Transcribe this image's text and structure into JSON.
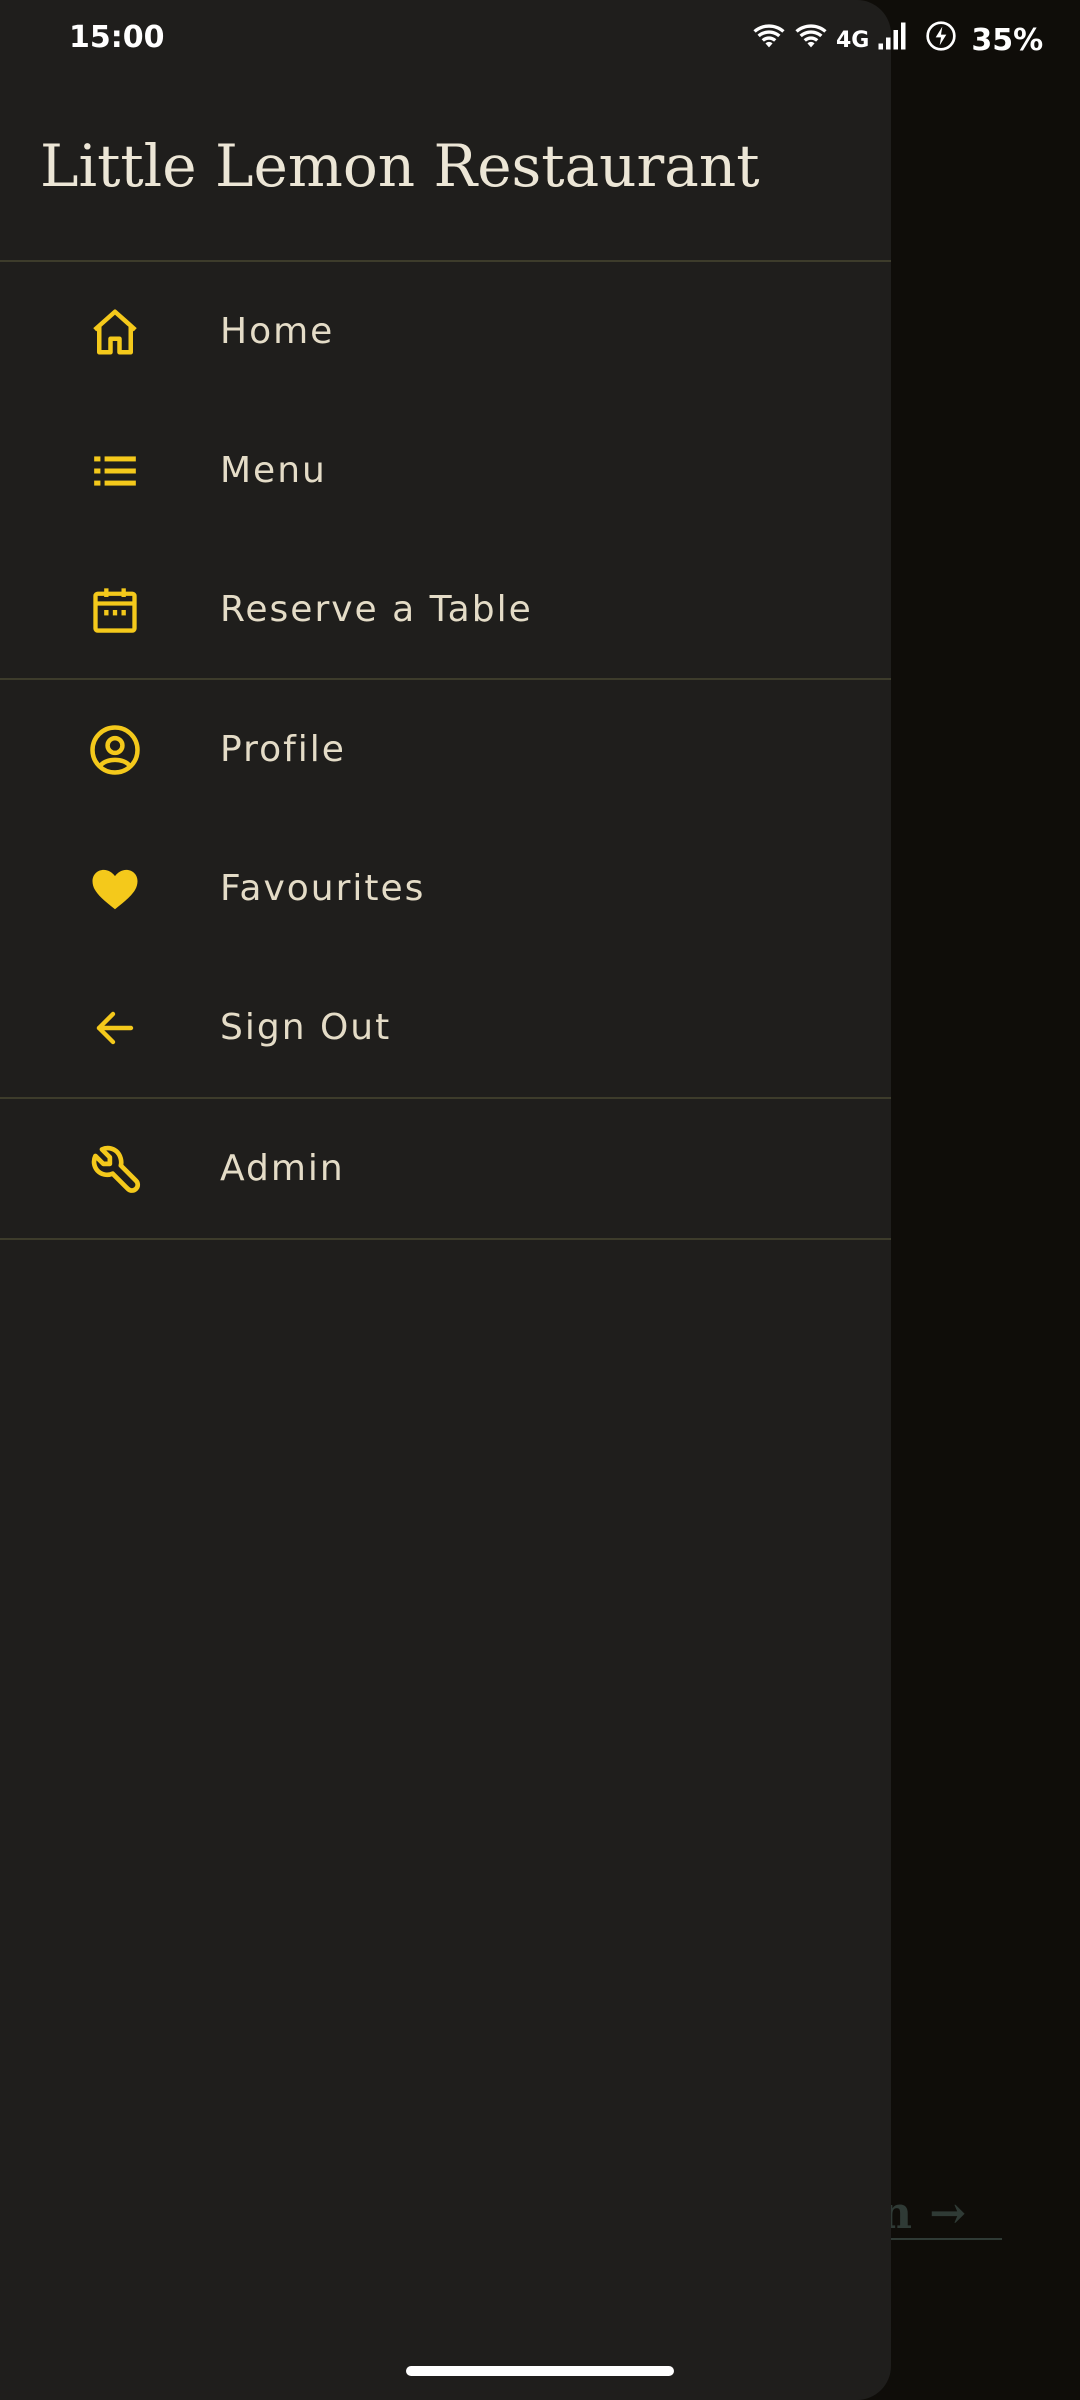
{
  "status_bar": {
    "time": "15:00",
    "network": "4G",
    "battery": "35%"
  },
  "drawer": {
    "title": "Little Lemon Restaurant",
    "items": [
      {
        "label": "Home",
        "icon": "home-icon"
      },
      {
        "label": "Menu",
        "icon": "list-icon"
      },
      {
        "label": "Reserve a Table",
        "icon": "calendar-icon"
      },
      {
        "label": "Profile",
        "icon": "profile-icon"
      },
      {
        "label": "Favourites",
        "icon": "heart-icon"
      },
      {
        "label": "Sign Out",
        "icon": "arrow-back-icon"
      },
      {
        "label": "Admin",
        "icon": "wrench-icon"
      }
    ]
  },
  "background": {
    "link_text": "n →"
  },
  "colors": {
    "accent": "#f4c91b",
    "drawer_bg": "#1f1e1c",
    "label": "#e4dcc7"
  }
}
